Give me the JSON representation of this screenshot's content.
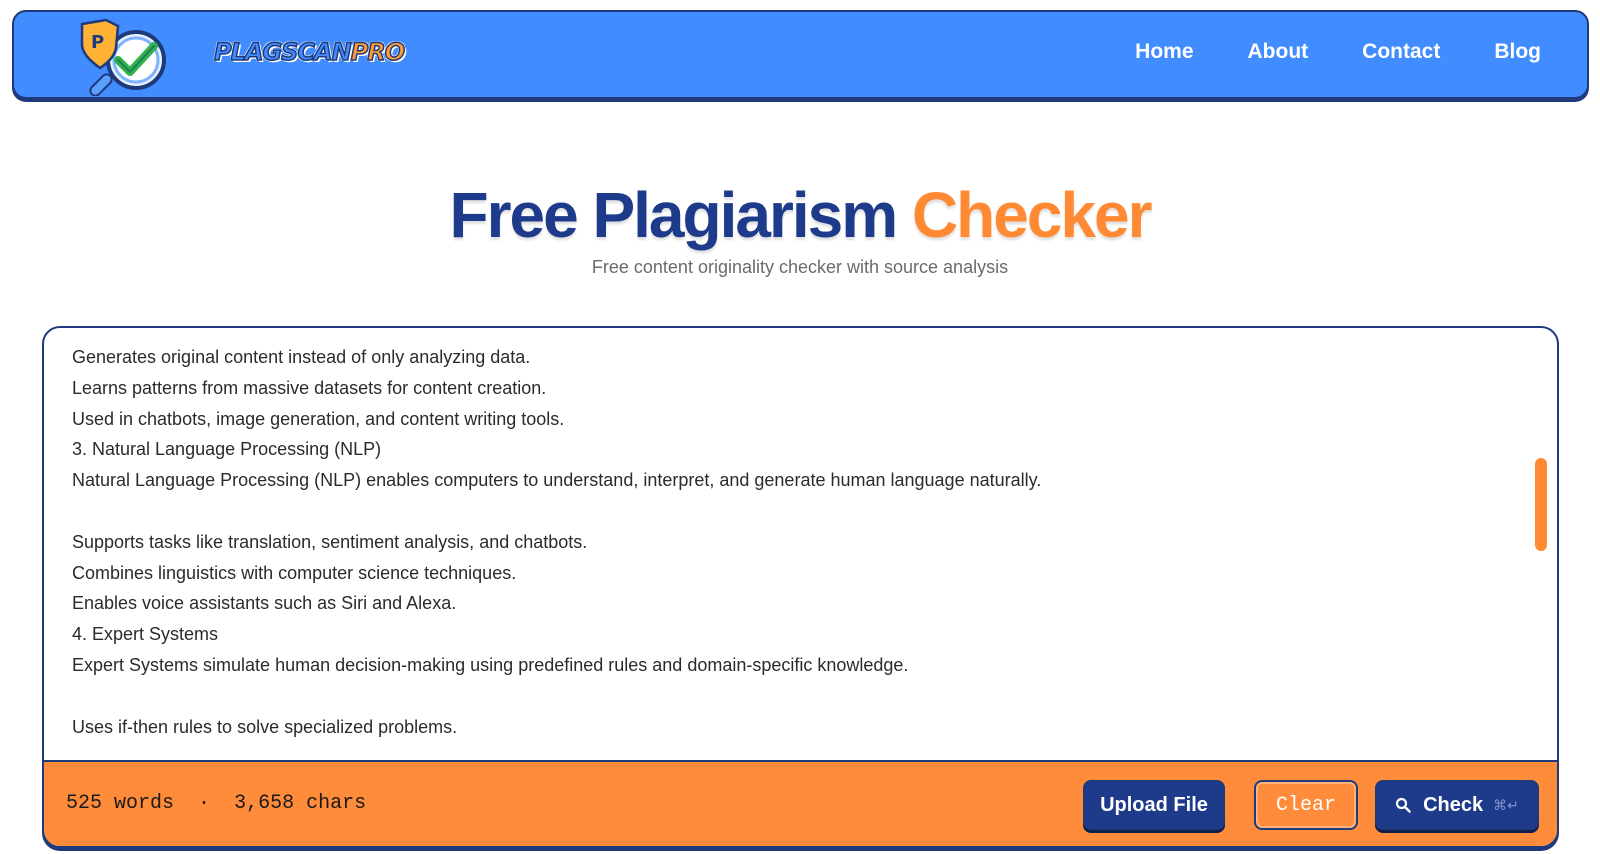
{
  "brand": {
    "name_main": "PLAGSCAN",
    "name_accent": "PRO",
    "colors": {
      "primary": "#418cff",
      "navy": "#1e3a8a",
      "accent": "#ff8a33"
    }
  },
  "nav": {
    "items": [
      {
        "label": "Home"
      },
      {
        "label": "About"
      },
      {
        "label": "Contact"
      },
      {
        "label": "Blog"
      }
    ]
  },
  "hero": {
    "title_main": "Free Plagiarism ",
    "title_accent": "Checker",
    "subtitle": "Free content originality checker with source analysis"
  },
  "editor": {
    "lines": [
      "Generates original content instead of only analyzing data.",
      "Learns patterns from massive datasets for content creation.",
      "Used in chatbots, image generation, and content writing tools.",
      "3. Natural Language Processing (NLP)",
      "Natural Language Processing (NLP) enables computers to understand, interpret, and generate human language naturally.",
      "",
      "Supports tasks like translation, sentiment analysis, and chatbots.",
      "Combines linguistics with computer science techniques.",
      "Enables voice assistants such as Siri and Alexa.",
      "4. Expert Systems",
      "Expert Systems simulate human decision-making using predefined rules and domain-specific knowledge.",
      "",
      "Uses if-then rules to solve specialized problems."
    ]
  },
  "footer": {
    "words": "525 words",
    "separator": "·",
    "chars": "3,658 chars",
    "upload_label": "Upload File",
    "clear_label": "Clear",
    "check_label": "Check",
    "check_shortcut": "⌘↵"
  },
  "icons": {
    "logo": "magnifier-shield-check-icon",
    "check_button": "search-icon"
  }
}
